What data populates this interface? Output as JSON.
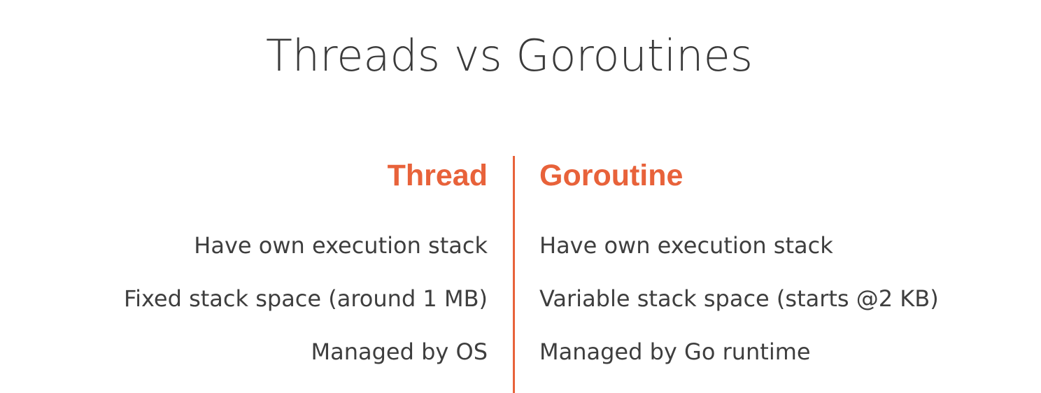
{
  "title": "Threads vs Goroutines",
  "accent_color": "#e8623a",
  "left_column": {
    "header": "Thread",
    "rows": [
      "Have own execution stack",
      "Fixed stack space (around 1 MB)",
      "Managed by OS"
    ]
  },
  "right_column": {
    "header": "Goroutine",
    "rows": [
      "Have own execution stack",
      "Variable stack space (starts @2 KB)",
      "Managed by Go runtime"
    ]
  }
}
